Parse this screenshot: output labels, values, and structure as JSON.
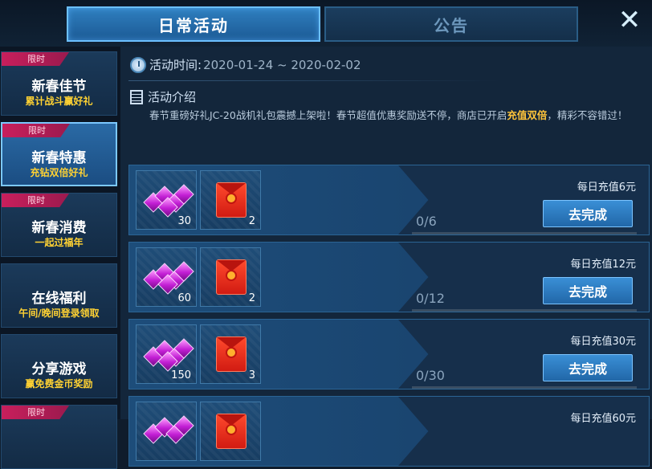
{
  "tabs": [
    {
      "label": "日常活动",
      "active": true
    },
    {
      "label": "公告",
      "active": false
    }
  ],
  "close_glyph": "✕",
  "sidebar": {
    "items": [
      {
        "badge": "限时",
        "title": "新春佳节",
        "subtitle": "累计战斗赢好礼",
        "active": false
      },
      {
        "badge": "限时",
        "title": "新春特惠",
        "subtitle": "充钻双倍好礼",
        "active": true
      },
      {
        "badge": "限时",
        "title": "新春消费",
        "subtitle": "一起过福年",
        "active": false
      },
      {
        "badge": "",
        "title": "在线福利",
        "subtitle": "午间/晚间登录领取",
        "active": false
      },
      {
        "badge": "",
        "title": "分享游戏",
        "subtitle": "赢免费金币奖励",
        "active": false
      },
      {
        "badge": "限时",
        "title": "",
        "subtitle": "",
        "active": false
      }
    ]
  },
  "activity": {
    "time_label": "活动时间:",
    "time_value": "2020-01-24 ~ 2020-02-02",
    "intro_title": "活动介绍",
    "intro_before": "春节重磅好礼JC-20战机礼包震撼上架啦！春节超值优惠奖励送不停，商店已开启",
    "intro_highlight": "充值双倍",
    "intro_after": "，精彩不容错过！"
  },
  "tasks": [
    {
      "label": "每日充值6元",
      "gem_qty": "30",
      "envelope_qty": "2",
      "progress": "0/6",
      "progress_fraction": 0,
      "button": "去完成"
    },
    {
      "label": "每日充值12元",
      "gem_qty": "60",
      "envelope_qty": "2",
      "progress": "0/12",
      "progress_fraction": 0,
      "button": "去完成"
    },
    {
      "label": "每日充值30元",
      "gem_qty": "150",
      "envelope_qty": "3",
      "progress": "0/30",
      "progress_fraction": 0,
      "button": "去完成"
    },
    {
      "label": "每日充值60元",
      "gem_qty": "",
      "envelope_qty": "",
      "progress": "",
      "progress_fraction": 0,
      "button": ""
    }
  ],
  "icons": {
    "clock": "clock-icon",
    "intro": "document-icon",
    "gem": "gem-icon",
    "envelope": "red-envelope-icon",
    "close": "close-icon"
  },
  "colors": {
    "highlight": "#ffc43a",
    "subtitle": "#ffd233",
    "badge": "#c81f5c",
    "button": "#2f7fc4"
  }
}
